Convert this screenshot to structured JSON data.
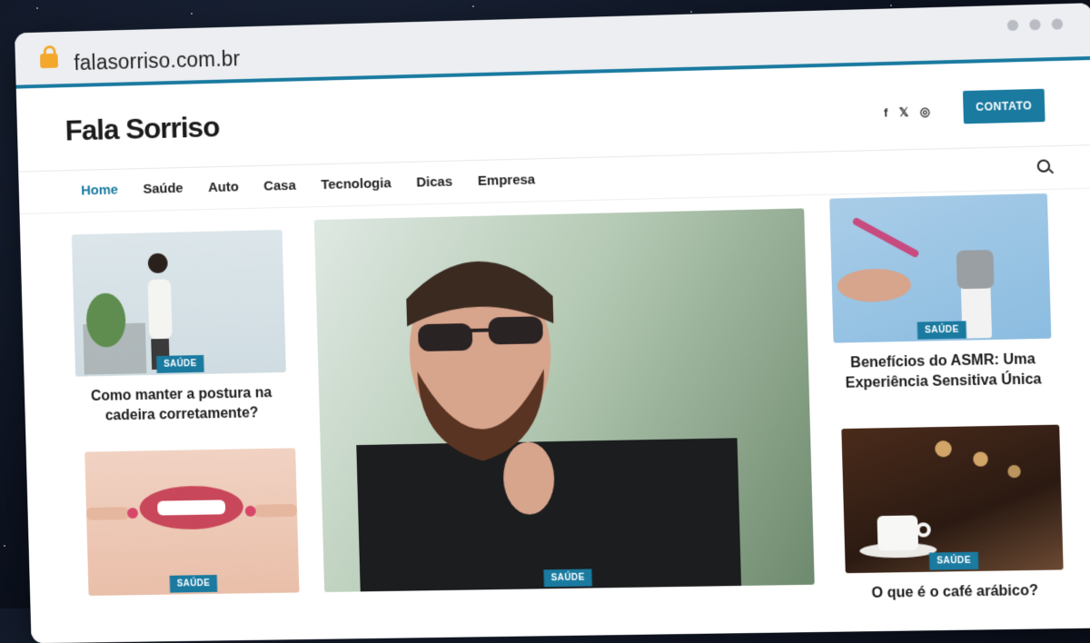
{
  "browser": {
    "url": "falasorriso.com.br"
  },
  "site": {
    "logo": "Fala Sorriso",
    "social": [
      "f",
      "𝕏",
      "◎"
    ],
    "contact_label": "CONTATO",
    "nav": [
      "Home",
      "Saúde",
      "Auto",
      "Casa",
      "Tecnologia",
      "Dicas",
      "Empresa"
    ],
    "active_nav": "Home"
  },
  "articles": {
    "left_top": {
      "category": "SAÚDE",
      "title": "Como manter a postura na cadeira corretamente?"
    },
    "left_bottom": {
      "category": "SAÚDE"
    },
    "main": {
      "category": "SAÚDE"
    },
    "right_top": {
      "category": "SAÚDE",
      "title": "Benefícios do ASMR: Uma Experiência Sensitiva Única"
    },
    "right_bottom": {
      "category": "SAÚDE",
      "title": "O que é o café arábico?"
    }
  },
  "colors": {
    "accent": "#1a7aa0",
    "lock": "#f3a72b"
  }
}
